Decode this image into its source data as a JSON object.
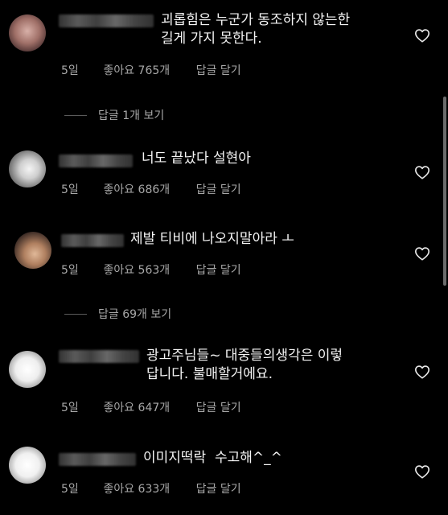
{
  "comments": [
    {
      "text": "괴롭힘은 누군가 동조하지 않는한\n길게 가지 못한다.",
      "time": "5일",
      "likes": "좋아요 765개",
      "reply": "답글 달기",
      "view_replies": "답글 1개 보기"
    },
    {
      "text": "너도 끝났다 설현아",
      "time": "5일",
      "likes": "좋아요 686개",
      "reply": "답글 달기"
    },
    {
      "text": "제발 티비에 나오지말아라 ㅗ",
      "time": "5일",
      "likes": "좋아요 563개",
      "reply": "답글 달기",
      "view_replies": "답글 69개 보기"
    },
    {
      "text": "광고주님들~ 대중들의생각은 이렇\n답니다. 불매할거에요.",
      "time": "5일",
      "likes": "좋아요 647개",
      "reply": "답글 달기"
    },
    {
      "text": "이미지떡락  수고해^_^",
      "time": "5일",
      "likes": "좋아요 633개",
      "reply": "답글 달기"
    }
  ],
  "colors": {
    "background": "#000000",
    "text": "#f5f5f5",
    "meta": "#a8a8a8"
  }
}
